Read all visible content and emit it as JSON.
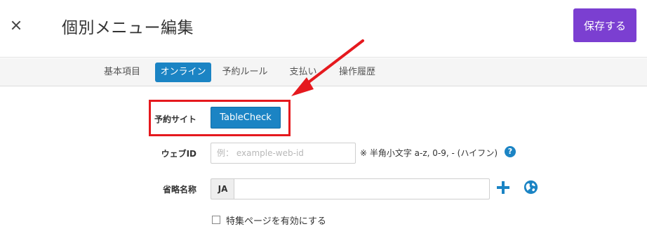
{
  "header": {
    "title": "個別メニュー編集",
    "save_label": "保存する",
    "close_icon": "close-icon"
  },
  "tabs": [
    {
      "label": "基本項目",
      "active": false
    },
    {
      "label": "オンライン",
      "active": true
    },
    {
      "label": "予約ルール",
      "active": false
    },
    {
      "label": "支払い",
      "active": false
    },
    {
      "label": "操作履歴",
      "active": false
    }
  ],
  "form": {
    "booking_site": {
      "label": "予約サイト",
      "value": "TableCheck"
    },
    "web_id": {
      "label": "ウェブID",
      "value": "",
      "placeholder": "例： example-web-id",
      "hint": "※ 半角小文字 a-z, 0-9, - (ハイフン)"
    },
    "short_name": {
      "label": "省略名称",
      "lang": "JA",
      "value": ""
    },
    "feature_page": {
      "label": "特集ページを有効にする",
      "checked": false
    }
  },
  "annotation": {
    "highlight_color": "#e5191e"
  },
  "colors": {
    "accent": "#1b84c4",
    "primary_button": "#7b3fd1"
  }
}
